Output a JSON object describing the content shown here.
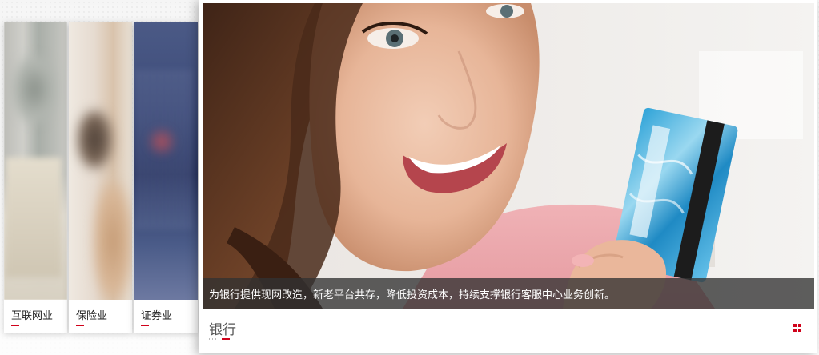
{
  "cards": [
    {
      "label": "互联网业"
    },
    {
      "label": "保险业"
    },
    {
      "label": "证券业"
    }
  ],
  "featured": {
    "title": "银行",
    "caption": "为银行提供现网改造，新老平台共存，降低投资成本，持续支撑银行客服中心业务创新。",
    "icon": "grid-icon"
  },
  "colors": {
    "accent": "#d0021b",
    "caption_bg": "#323232"
  }
}
